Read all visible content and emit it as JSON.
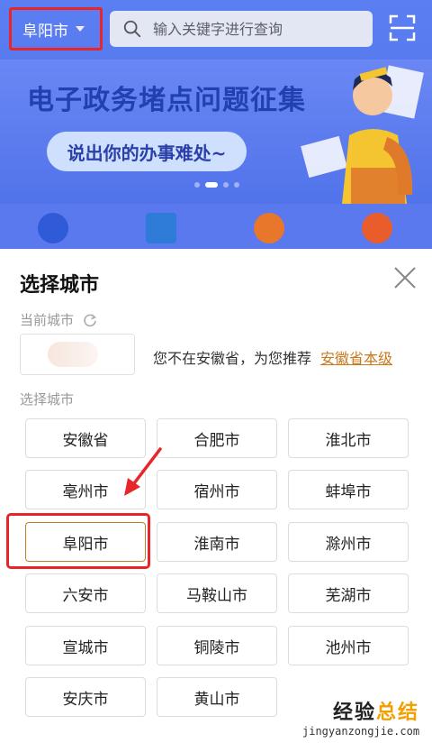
{
  "header": {
    "city": "阜阳市",
    "search_placeholder": "输入关键字进行查询"
  },
  "banner": {
    "title": "电子政务堵点问题征集",
    "subtitle": "说出你的办事难处~",
    "dots_count": 4,
    "active_dot": 1
  },
  "sheet": {
    "title": "选择城市",
    "current_city_label": "当前城市",
    "recommend_text": "您不在安徽省，为您推荐",
    "recommend_link": "安徽省本级",
    "select_label": "选择城市",
    "cities": [
      "安徽省",
      "合肥市",
      "淮北市",
      "亳州市",
      "宿州市",
      "蚌埠市",
      "阜阳市",
      "淮南市",
      "滁州市",
      "六安市",
      "马鞍山市",
      "芜湖市",
      "宣城市",
      "铜陵市",
      "池州市",
      "安庆市",
      "黄山市"
    ],
    "selected_city": "阜阳市"
  },
  "watermark": {
    "main_left": "经验",
    "main_right": "总结",
    "sub": "jingyanzongjie.com"
  },
  "colors": {
    "brand_blue": "#4e6fe6",
    "highlight_red": "#e8262a",
    "link_orange": "#c77a1c",
    "selected_border": "#c67b2a"
  }
}
